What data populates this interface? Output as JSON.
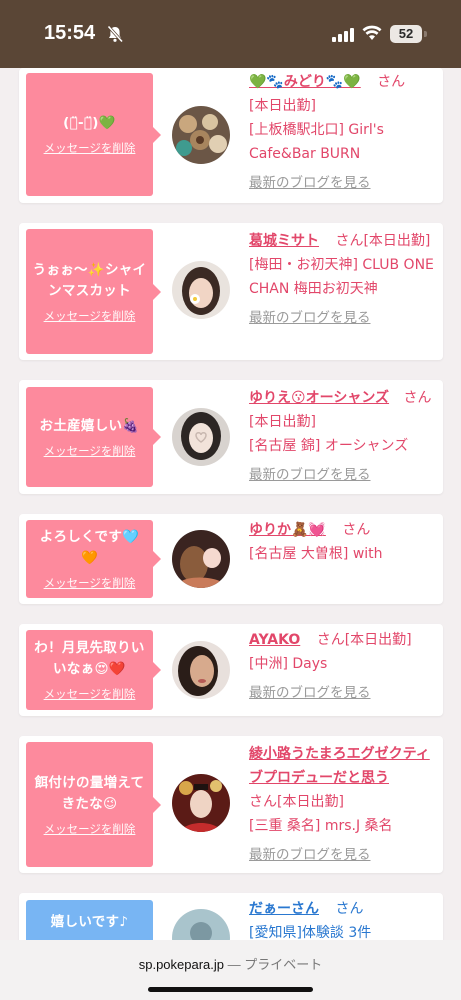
{
  "status": {
    "time": "15:54",
    "battery": "52"
  },
  "browser": {
    "domain": "sp.pokepara.jp",
    "separator": " — ",
    "mode": "プライベート"
  },
  "common": {
    "delete_label": "メッセージを削除",
    "blog_label": "最新のブログを見る",
    "san": "さん"
  },
  "cards": [
    {
      "message": "(ㅎ̈-ㅎ̈)💚",
      "name": "💚🐾みどり🐾💚",
      "status": "[本日出勤]",
      "shop": "[上板橋駅北口] Girl's Cafe&Bar BURN"
    },
    {
      "message": "うぉぉ〜✨シャインマスカット",
      "name": "葛城ミサト",
      "status": "[本日出勤]",
      "shop": "[梅田・お初天神] CLUB ONE CHAN 梅田お初天神"
    },
    {
      "message": "お土産嬉しい🍇",
      "name": "ゆりえ😗オーシャンズ",
      "status": "[本日出勤]",
      "shop": "[名古屋 錦] オーシャンズ"
    },
    {
      "message": "よろしくです🩵🧡",
      "name": "ゆりか🧸💓",
      "status": "",
      "shop": "[名古屋 大曽根] with"
    },
    {
      "message": "わ！月見先取りいいなぁ😍❤️",
      "name": "AYAKO",
      "status": "[本日出勤]",
      "shop": "[中洲] Days"
    },
    {
      "message": "餌付けの量増えてきたな😉",
      "name": "綾小路うたまろエグゼクティブプロデューだと思う",
      "status": "[本日出勤]",
      "shop": "[三重 桑名] mrs.J 桑名"
    },
    {
      "message": "嬉しいです♪",
      "name": "だぁーさん",
      "status": "",
      "shop": "[愛知県]体験談 3件"
    }
  ]
}
